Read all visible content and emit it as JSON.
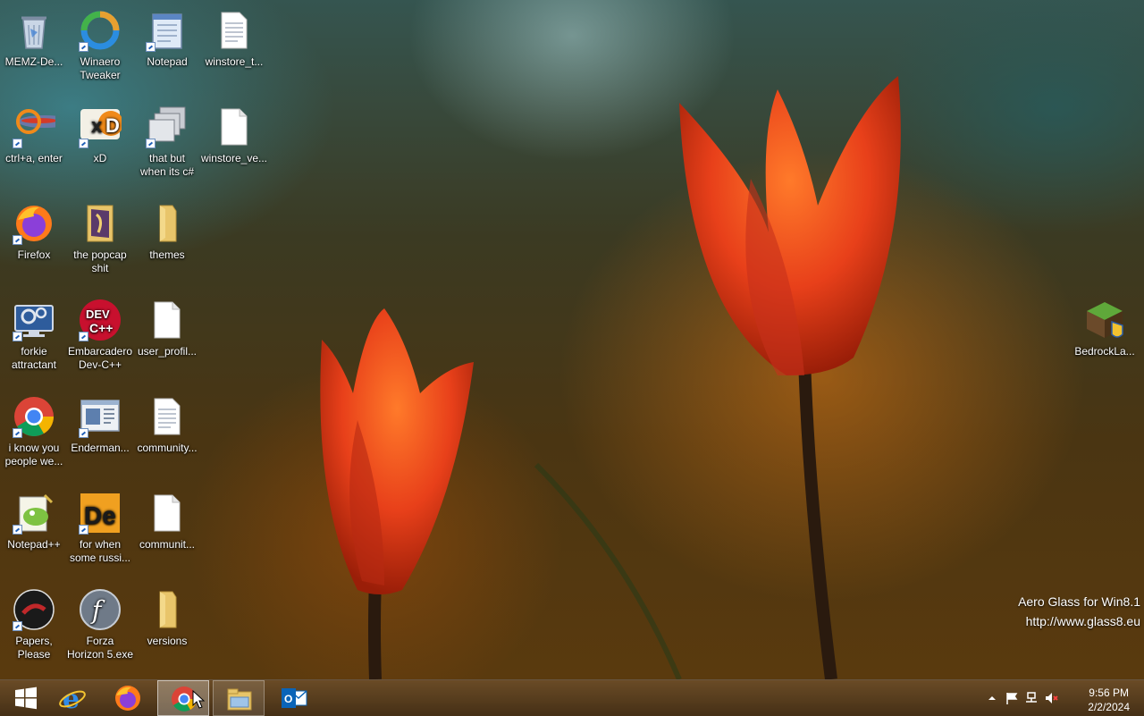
{
  "desktop": {
    "icons": [
      {
        "label": "MEMZ-De...",
        "icon": "recycle-bin-icon",
        "shortcut": false
      },
      {
        "label": "Winaero\nTweaker",
        "icon": "winaero-tweaker-icon",
        "shortcut": true
      },
      {
        "label": "Notepad",
        "icon": "notepad-icon",
        "shortcut": true
      },
      {
        "label": "winstore_t...",
        "icon": "text-file-icon",
        "shortcut": false
      },
      {
        "label": "ctrl+a, enter",
        "icon": "fish-icon",
        "shortcut": true
      },
      {
        "label": "xD",
        "icon": "xd-icon",
        "shortcut": true
      },
      {
        "label": "that but\nwhen its c#",
        "icon": "windows-stack-icon",
        "shortcut": true
      },
      {
        "label": "winstore_ve...",
        "icon": "blank-file-icon",
        "shortcut": false
      },
      {
        "label": "Firefox",
        "icon": "firefox-icon",
        "shortcut": true
      },
      {
        "label": "the popcap\nshit",
        "icon": "folder-icon",
        "shortcut": false
      },
      {
        "label": "themes",
        "icon": "folder-icon",
        "shortcut": false
      },
      {
        "label": "forkie\nattractant",
        "icon": "settings-monitor-icon",
        "shortcut": true
      },
      {
        "label": "Embarcadero\nDev-C++",
        "icon": "devcpp-icon",
        "shortcut": true
      },
      {
        "label": "user_profil...",
        "icon": "blank-file-icon",
        "shortcut": false
      },
      {
        "label": "i know you\npeople we...",
        "icon": "chrome-icon",
        "shortcut": true
      },
      {
        "label": "Enderman...",
        "icon": "window-app-icon",
        "shortcut": true
      },
      {
        "label": "community...",
        "icon": "text-file-icon",
        "shortcut": false
      },
      {
        "label": "Notepad++",
        "icon": "notepadpp-icon",
        "shortcut": true
      },
      {
        "label": "for when\nsome russi...",
        "icon": "de-icon",
        "shortcut": true
      },
      {
        "label": "communit...",
        "icon": "blank-file-icon",
        "shortcut": false
      },
      {
        "label": "Papers,\nPlease",
        "icon": "papers-please-icon",
        "shortcut": true
      },
      {
        "label": "Forza\nHorizon 5.exe",
        "icon": "flash-icon",
        "shortcut": false
      },
      {
        "label": "versions",
        "icon": "folder-icon",
        "shortcut": false
      },
      {
        "label": "BedrockLa...",
        "icon": "minecraft-icon",
        "shortcut": false
      }
    ]
  },
  "watermark": {
    "line1": "Aero Glass for Win8.1",
    "line2": "http://www.glass8.eu"
  },
  "taskbar": {
    "buttons": [
      {
        "name": "start",
        "icon": "windows-logo-icon"
      },
      {
        "name": "internet-explorer",
        "icon": "internet-explorer-icon"
      },
      {
        "name": "firefox",
        "icon": "firefox-icon"
      },
      {
        "name": "chrome",
        "icon": "chrome-icon",
        "state": "active"
      },
      {
        "name": "file-explorer",
        "icon": "file-explorer-icon",
        "state": "pinned"
      },
      {
        "name": "outlook",
        "icon": "outlook-icon"
      }
    ],
    "tray": {
      "icons": [
        "show-hidden-icons-icon",
        "action-center-flag-icon",
        "network-icon",
        "volume-muted-icon"
      ],
      "time": "9:56 PM",
      "date": "2/2/2024"
    }
  },
  "colors": {
    "accent": "#1f5fb7",
    "taskbar": "#5a3e1e",
    "folder": "#e8c56a"
  }
}
